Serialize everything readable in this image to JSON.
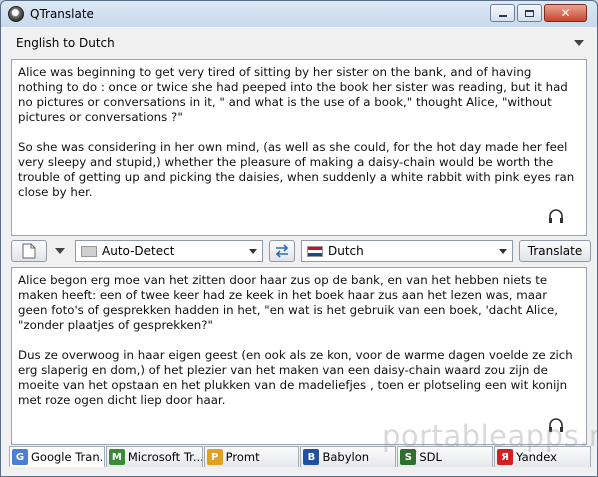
{
  "window": {
    "title": "QTranslate"
  },
  "direction_label": "English to Dutch",
  "source": {
    "paragraphs": [
      "Alice was beginning to get very tired of sitting by her sister on the bank, and of having nothing to do : once or twice she had peeped into the book her sister was reading, but it had no pictures or conversations in it, \" and what is the use of a book,\" thought Alice, \"without pictures or conversations ?\"",
      "So she was considering in her own mind, (as well as she could, for the hot day made her feel very sleepy and stupid,) whether the pleasure of making a daisy-chain would be worth the trouble of getting up and picking the daisies, when suddenly a white rabbit with pink eyes ran close by her."
    ]
  },
  "toolbar": {
    "source_lang": "Auto-Detect",
    "target_lang": "Dutch",
    "translate_label": "Translate"
  },
  "result": {
    "paragraphs": [
      "Alice begon erg moe van het zitten door haar zus op de bank, en van het hebben niets te maken heeft: een of twee keer had ze keek in het boek haar zus aan het lezen was, maar geen foto's of gesprekken hadden in het, \"en wat is het gebruik van een boek, 'dacht Alice, \"zonder plaatjes of gesprekken?\"",
      "Dus ze overwoog in haar eigen geest (en ook als ze kon, voor de warme dagen voelde ze zich erg slaperig en dom,) of het plezier van het maken van een daisy-chain waard zou zijn de moeite van het opstaan en het plukken van de madeliefjes , toen er plotseling een wit konijn met roze ogen dicht liep door haar."
    ]
  },
  "tabs": [
    {
      "label": "Google Tran...",
      "icon": "google-icon",
      "color": "#4a7fd4",
      "active": true
    },
    {
      "label": "Microsoft Tr...",
      "icon": "microsoft-icon",
      "color": "#3a8a3a",
      "active": false
    },
    {
      "label": "Promt",
      "icon": "promt-icon",
      "color": "#e0a020",
      "active": false
    },
    {
      "label": "Babylon",
      "icon": "babylon-icon",
      "color": "#2050a0",
      "active": false
    },
    {
      "label": "SDL",
      "icon": "sdl-icon",
      "color": "#2e6e2e",
      "active": false
    },
    {
      "label": "Yandex",
      "icon": "yandex-icon",
      "color": "#d42020",
      "active": false
    }
  ],
  "watermark": "portableapps.nl"
}
